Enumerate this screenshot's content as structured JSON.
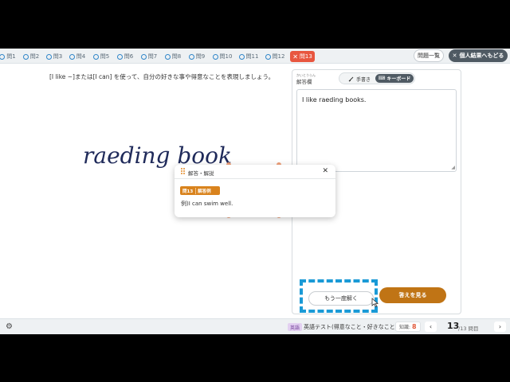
{
  "question_tabs": [
    "問1",
    "問2",
    "問3",
    "問4",
    "問5",
    "問6",
    "問7",
    "問8",
    "問9",
    "問10",
    "問11",
    "問12"
  ],
  "active_tab": {
    "label": "問13"
  },
  "header": {
    "list_button": "問題一覧",
    "back_button": "個人結果へもどる",
    "back_ruby": "こじん けっか"
  },
  "instruction": "[I like ~]または[I can] を使って、自分の好きな事や得意なことを表現しましょう。",
  "handwriting_text": "raeding books.",
  "panel": {
    "label": "解答欄",
    "label_ruby": "かいとうらん",
    "mode_handwriting": "手書き",
    "mode_handwriting_ruby": "てが",
    "mode_keyboard": "キーボード",
    "answer_text": "I like raeding books."
  },
  "retry_button": "もう一度解く",
  "retry_ruby": "いちど と",
  "show_answer_button": "答えを見る",
  "show_answer_ruby": "こた み",
  "popup": {
    "title": "解答・解説",
    "badge_number": "問13",
    "badge_ruby": "かいとうれい",
    "badge_text": "解答例",
    "example": "例)I can swim well."
  },
  "footer": {
    "subject": "英語",
    "test_name": "英語テスト(得意なこと・好きなこと)",
    "score_label": "知識:",
    "score_value": "8",
    "page_current": "13",
    "page_rest": "/13 問目"
  },
  "colors": {
    "active_tab": "#e8563f",
    "show_button": "#c07415",
    "dash": "#1a9ad6"
  }
}
